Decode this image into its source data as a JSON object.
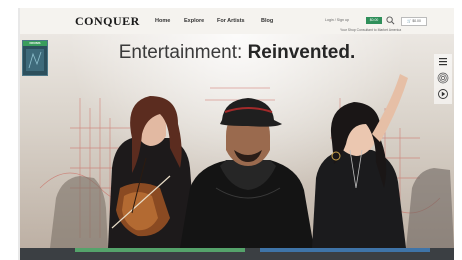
{
  "brand": {
    "logo_text": "CONQUER"
  },
  "nav": {
    "items": [
      "Home",
      "Explore",
      "For Artists",
      "Blog"
    ]
  },
  "utility": {
    "login_text": "Login / Sign up",
    "cart_badge": "$0.00",
    "cart_label": "$0.00",
    "tagline": "Your Shop Consultant to Market America"
  },
  "hero": {
    "headline_regular": "Entertainment: ",
    "headline_bold": "Reinvented."
  },
  "side_badge": {
    "ribbon": "DRUMS"
  },
  "colors": {
    "accent_green": "#55a36b",
    "accent_blue": "#3f74a8",
    "dark": "#3b3f43"
  },
  "icons": [
    "search-icon",
    "menu-icon",
    "fingerprint-icon",
    "play-icon"
  ]
}
